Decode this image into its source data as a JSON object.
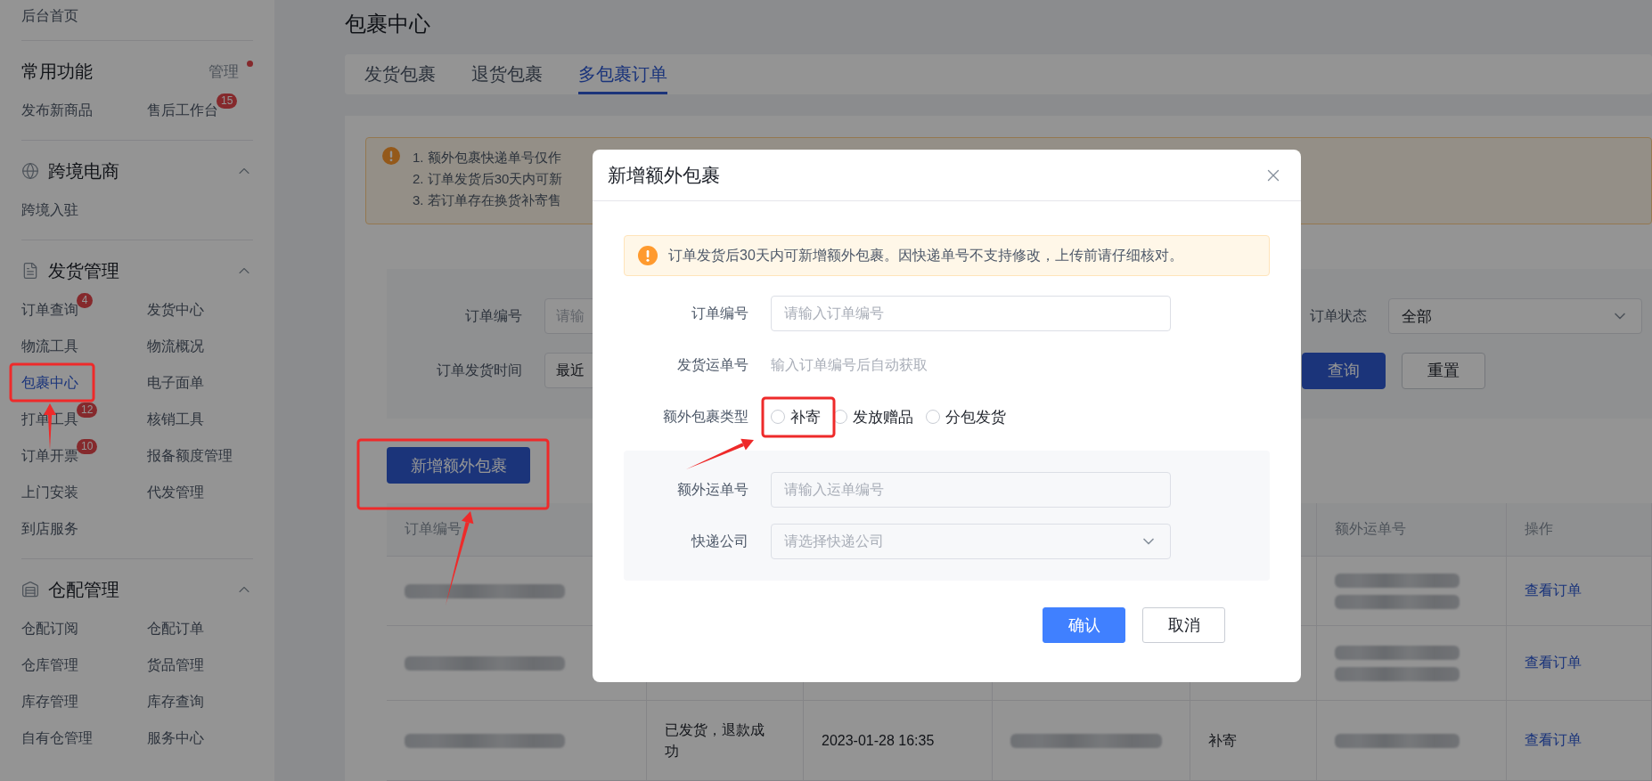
{
  "sidebar": {
    "home": "后台首页",
    "sections": [
      {
        "title": "常用功能",
        "manage": {
          "label": "管理",
          "dot": true
        },
        "items": [
          {
            "label": "发布新商品",
            "selected": false
          },
          {
            "label": "售后工作台",
            "badge": "15",
            "selected": false
          }
        ]
      },
      {
        "title": "跨境电商",
        "expanded": true,
        "items": [
          {
            "label": "跨境入驻",
            "selected": false
          }
        ]
      },
      {
        "title": "发货管理",
        "expanded": true,
        "items": [
          {
            "label": "订单查询",
            "badge": "4",
            "selected": false
          },
          {
            "label": "发货中心",
            "selected": false
          },
          {
            "label": "物流工具",
            "selected": false
          },
          {
            "label": "物流概况",
            "selected": false
          },
          {
            "label": "包裹中心",
            "selected": true
          },
          {
            "label": "电子面单",
            "selected": false
          },
          {
            "label": "打单工具",
            "badge": "12",
            "selected": false
          },
          {
            "label": "核销工具",
            "selected": false
          },
          {
            "label": "订单开票",
            "badge": "10",
            "selected": false
          },
          {
            "label": "报备额度管理",
            "selected": false
          },
          {
            "label": "上门安装",
            "selected": false
          },
          {
            "label": "代发管理",
            "selected": false
          },
          {
            "label": "到店服务",
            "selected": false
          }
        ]
      },
      {
        "title": "仓配管理",
        "expanded": true,
        "items": [
          {
            "label": "仓配订阅",
            "selected": false
          },
          {
            "label": "仓配订单",
            "selected": false
          },
          {
            "label": "仓库管理",
            "selected": false
          },
          {
            "label": "货品管理",
            "selected": false
          },
          {
            "label": "库存管理",
            "selected": false
          },
          {
            "label": "库存查询",
            "selected": false
          },
          {
            "label": "自有仓管理",
            "selected": false
          },
          {
            "label": "服务中心",
            "selected": false
          }
        ]
      }
    ]
  },
  "page": {
    "title": "包裹中心",
    "tabs": [
      {
        "label": "发货包裹",
        "selected": false
      },
      {
        "label": "退货包裹",
        "selected": false
      },
      {
        "label": "多包裹订单",
        "selected": true
      }
    ]
  },
  "notice": {
    "lines": [
      "1. 额外包裹快递单号仅作",
      "2. 订单发货后30天内可新",
      "3. 若订单存在换货补寄售"
    ]
  },
  "filters": {
    "order_no": {
      "label": "订单编号",
      "placeholder": "请输"
    },
    "ship_time": {
      "label": "订单发货时间",
      "value": "最近"
    },
    "status": {
      "label": "订单状态",
      "value": "全部"
    },
    "query_button": "查询",
    "reset_button": "重置"
  },
  "add_button": "新增额外包裹",
  "table": {
    "columns": {
      "order_no": "订单编号",
      "extra_waybill": "额外运单号",
      "actions": "操作"
    },
    "rows": [
      {
        "action": "查看订单"
      },
      {
        "action": "查看订单"
      },
      {
        "status": "已发货，退款成功",
        "time": "2023-01-28 16:35",
        "type": "补寄",
        "action": "查看订单"
      }
    ]
  },
  "dialog": {
    "title": "新增额外包裹",
    "alert": "订单发货后30天内可新增额外包裹。因快递单号不支持修改，上传前请仔细核对。",
    "fields": [
      {
        "kind": "input",
        "label": "订单编号",
        "placeholder": "请输入订单编号"
      },
      {
        "kind": "hint",
        "label": "发货运单号",
        "hint": "输入订单编号后自动获取"
      },
      {
        "kind": "radio",
        "label": "额外包裹类型",
        "options": [
          {
            "label": "补寄",
            "selected": false
          },
          {
            "label": "发放赠品",
            "selected": false
          },
          {
            "label": "分包发货",
            "selected": false
          }
        ]
      }
    ],
    "sub_fields": [
      {
        "kind": "input",
        "label": "额外运单号",
        "placeholder": "请输入运单编号"
      },
      {
        "kind": "select",
        "label": "快递公司",
        "placeholder": "请选择快递公司"
      }
    ],
    "confirm": "确认",
    "cancel": "取消"
  }
}
